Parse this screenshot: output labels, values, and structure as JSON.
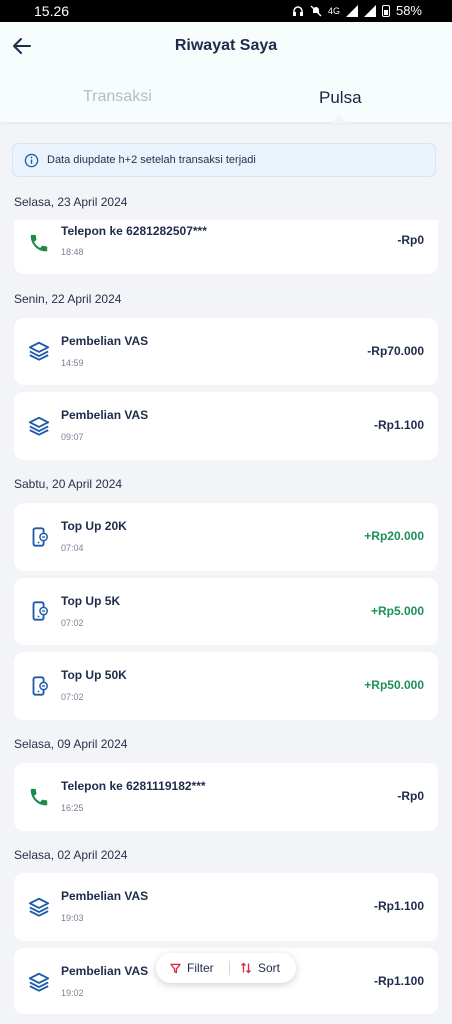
{
  "status_bar": {
    "time": "15.26",
    "network": "4G",
    "battery": "58%"
  },
  "header": {
    "title": "Riwayat Saya"
  },
  "tabs": [
    {
      "label": "Transaksi"
    },
    {
      "label": "Pulsa"
    }
  ],
  "info": {
    "text": "Data diupdate h+2 setelah transaksi terjadi"
  },
  "groups": [
    {
      "date": "Selasa, 23 April 2024"
    },
    {
      "date": "Senin, 22 April 2024"
    },
    {
      "date": "Sabtu, 20 April 2024"
    },
    {
      "date": "Selasa, 09 April 2024"
    },
    {
      "date": "Selasa, 02 April 2024"
    }
  ],
  "transactions": [
    {
      "title": "Telepon ke 6281282507***",
      "time": "18:48",
      "amount": "-Rp0",
      "icon": "phone-icon"
    },
    {
      "title": "Pembelian VAS",
      "time": "14:59",
      "amount": "-Rp70.000",
      "icon": "layers-icon"
    },
    {
      "title": "Pembelian VAS",
      "time": "09:07",
      "amount": "-Rp1.100",
      "icon": "layers-icon"
    },
    {
      "title": "Top Up 20K",
      "time": "07:04",
      "amount": "+Rp20.000",
      "icon": "mobile-topup-icon"
    },
    {
      "title": "Top Up 5K",
      "time": "07:02",
      "amount": "+Rp5.000",
      "icon": "mobile-topup-icon"
    },
    {
      "title": "Top Up 50K",
      "time": "07:02",
      "amount": "+Rp50.000",
      "icon": "mobile-topup-icon"
    },
    {
      "title": "Telepon ke 6281119182***",
      "time": "16:25",
      "amount": "-Rp0",
      "icon": "phone-icon"
    },
    {
      "title": "Pembelian VAS",
      "time": "19:03",
      "amount": "-Rp1.100",
      "icon": "layers-icon"
    },
    {
      "title": "Pembelian VAS",
      "time": "19:02",
      "amount": "-Rp1.100",
      "icon": "layers-icon"
    }
  ],
  "actions": {
    "filter_label": "Filter",
    "sort_label": "Sort"
  },
  "colors": {
    "accent_blue": "#1f5ca8",
    "positive_green": "#1d8f5a",
    "phone_green": "#1b8a4c",
    "filter_red": "#d9283b"
  }
}
